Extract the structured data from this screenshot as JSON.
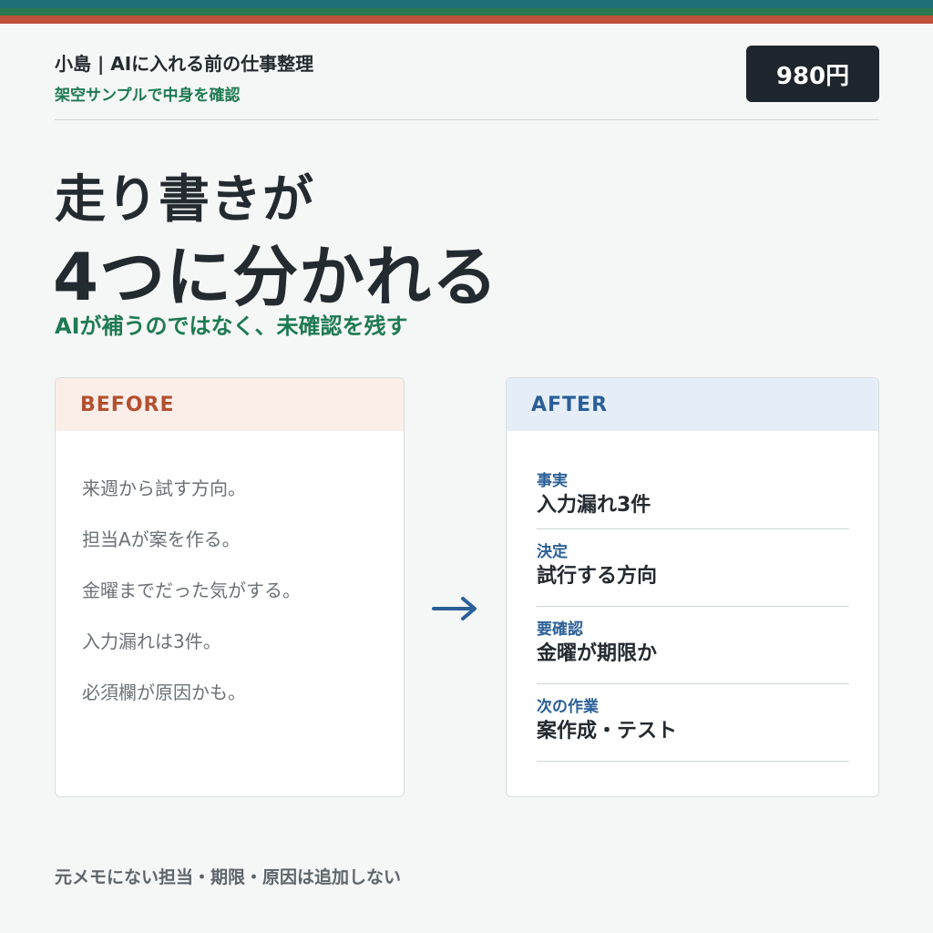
{
  "colors": {
    "stripe_top": "#1f6f78",
    "stripe_mid": "#2b7a4f",
    "stripe_bottom": "#c0513a",
    "accent_green": "#1e7a52",
    "before_accent": "#b3502f",
    "after_accent": "#2b5f97"
  },
  "header": {
    "brand": "小島 | AIに入れる前の仕事整理",
    "subtitle": "架空サンプルで中身を確認",
    "price": "980円"
  },
  "headline": {
    "line1": "走り書きが",
    "line2": "4つに分かれる",
    "tagline": "AIが補うのではなく、未確認を残す"
  },
  "before": {
    "title": "BEFORE",
    "lines": [
      "来週から試す方向。",
      "担当Aが案を作る。",
      "金曜までだった気がする。",
      "入力漏れは3件。",
      "必須欄が原因かも。"
    ]
  },
  "arrow_icon": "arrow-right-icon",
  "after": {
    "title": "AFTER",
    "fields": [
      {
        "label": "事実",
        "value": "入力漏れ3件"
      },
      {
        "label": "決定",
        "value": "試行する方向"
      },
      {
        "label": "要確認",
        "value": "金曜が期限か"
      },
      {
        "label": "次の作業",
        "value": "案作成・テスト"
      }
    ]
  },
  "footer": {
    "note": "元メモにない担当・期限・原因は追加しない"
  }
}
